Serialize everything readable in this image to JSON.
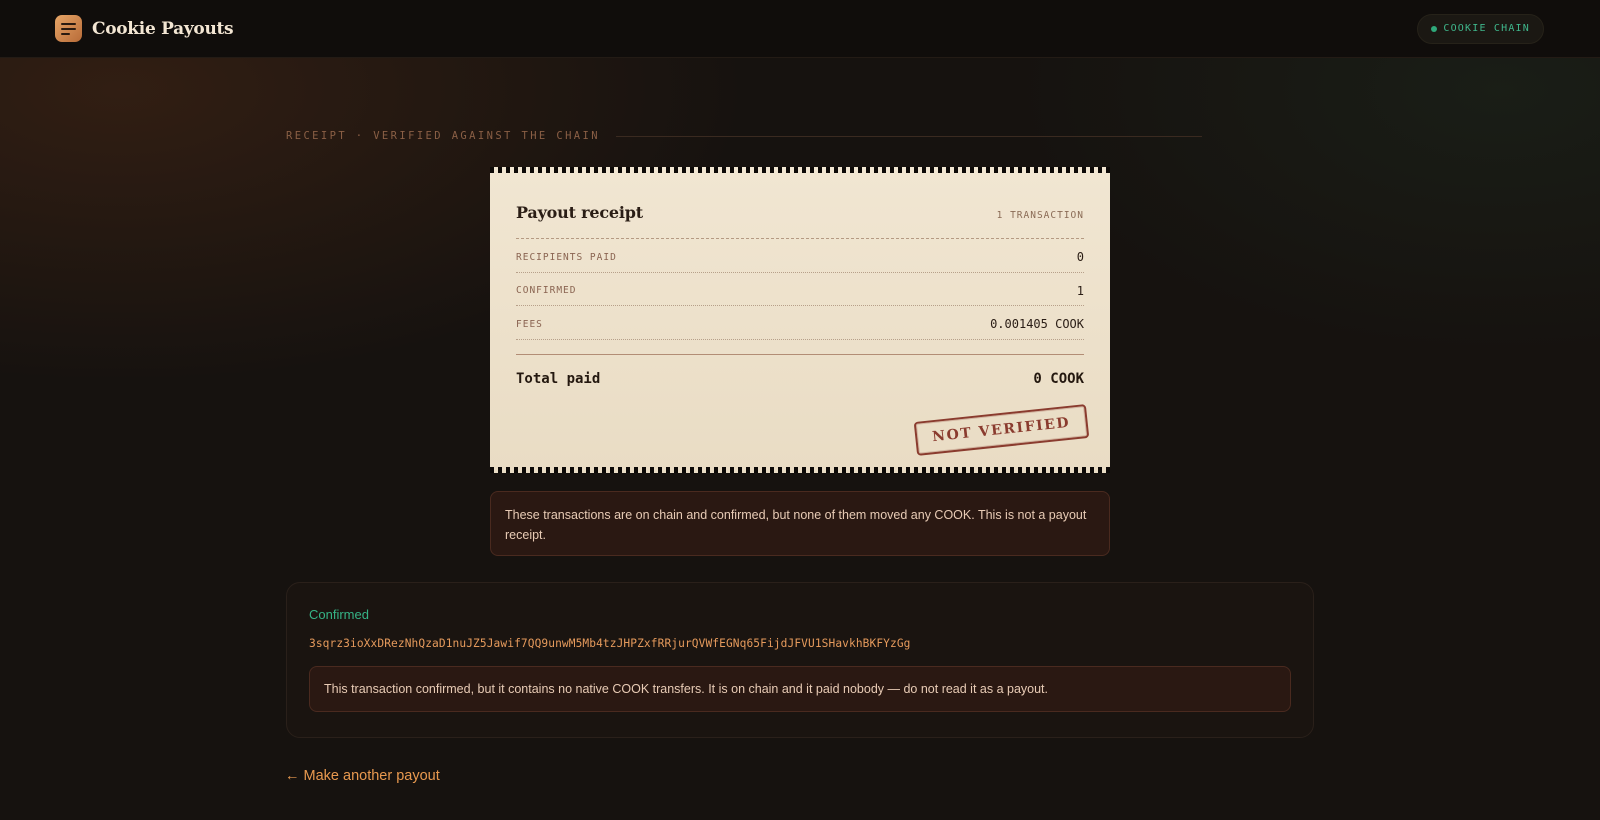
{
  "header": {
    "brand_name": "Cookie Payouts",
    "logo_icon": "receipt-lines-icon",
    "chain_badge": "COOKIE CHAIN",
    "chain_status_color": "#2fa87a"
  },
  "section": {
    "label": "RECEIPT · VERIFIED AGAINST THE CHAIN"
  },
  "receipt": {
    "title": "Payout receipt",
    "transaction_count": "1 TRANSACTION",
    "rows": [
      {
        "label": "RECIPIENTS PAID",
        "value": "0"
      },
      {
        "label": "CONFIRMED",
        "value": "1"
      },
      {
        "label": "FEES",
        "value": "0.001405 COOK"
      }
    ],
    "total_label": "Total paid",
    "total_value": "0 COOK",
    "stamp": "NOT VERIFIED"
  },
  "warning": {
    "text": "These transactions are on chain and confirmed, but none of them moved any COOK. This is not a payout receipt."
  },
  "transaction": {
    "status": "Confirmed",
    "status_color": "#36b386",
    "hash": "3sqrz3ioXxDRezNhQzaD1nuJZ5Jawif7QQ9unwM5Mb4tzJHPZxfRRjurQVWfEGNq65FijdJFVU1SHavkhBKFYzGg",
    "note": "This transaction confirmed, but it contains no native COOK transfers. It is on chain and it paid nobody — do not read it as a payout."
  },
  "footer": {
    "back_link": "← Make another payout"
  }
}
